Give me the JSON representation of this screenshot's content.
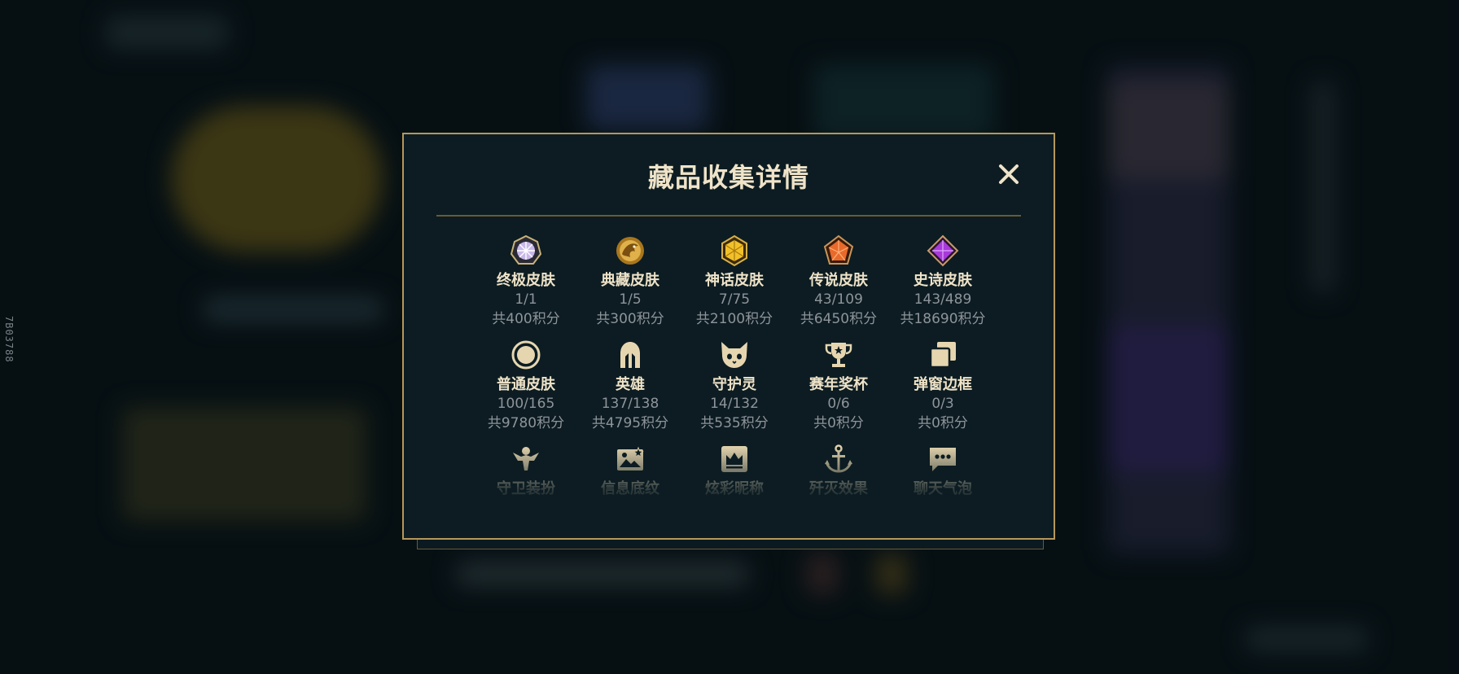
{
  "background": {
    "side_code": "7B03788"
  },
  "modal": {
    "title": "藏品收集详情",
    "close_label": "✕",
    "colors": {
      "accent": "#b5975a",
      "title": "#efe3c8",
      "muted": "#8e949a"
    },
    "rows": [
      [
        {
          "icon": "ultimate-skin-gem-icon",
          "name": "终极皮肤",
          "count": "1/1",
          "points": "共400积分"
        },
        {
          "icon": "collector-skin-dragon-icon",
          "name": "典藏皮肤",
          "count": "1/5",
          "points": "共300积分"
        },
        {
          "icon": "mythic-skin-gem-icon",
          "name": "神话皮肤",
          "count": "7/75",
          "points": "共2100积分"
        },
        {
          "icon": "legendary-skin-gem-icon",
          "name": "传说皮肤",
          "count": "43/109",
          "points": "共6450积分"
        },
        {
          "icon": "epic-skin-gem-icon",
          "name": "史诗皮肤",
          "count": "143/489",
          "points": "共18690积分"
        }
      ],
      [
        {
          "icon": "normal-skin-circle-icon",
          "name": "普通皮肤",
          "count": "100/165",
          "points": "共9780积分"
        },
        {
          "icon": "champion-helmet-icon",
          "name": "英雄",
          "count": "137/138",
          "points": "共4795积分"
        },
        {
          "icon": "guardian-creature-icon",
          "name": "守护灵",
          "count": "14/132",
          "points": "共535积分"
        },
        {
          "icon": "trophy-icon",
          "name": "赛年奖杯",
          "count": "0/6",
          "points": "共0积分"
        },
        {
          "icon": "popup-frame-icon",
          "name": "弹窗边框",
          "count": "0/3",
          "points": "共0积分"
        }
      ],
      [
        {
          "icon": "ward-skin-icon",
          "name": "守卫装扮",
          "count": "",
          "points": ""
        },
        {
          "icon": "profile-background-icon",
          "name": "信息底纹",
          "count": "",
          "points": ""
        },
        {
          "icon": "colorful-nickname-crown-icon",
          "name": "炫彩昵称",
          "count": "",
          "points": ""
        },
        {
          "icon": "elimination-effect-anchor-icon",
          "name": "歼灭效果",
          "count": "",
          "points": ""
        },
        {
          "icon": "chat-bubble-icon",
          "name": "聊天气泡",
          "count": "",
          "points": ""
        }
      ]
    ]
  }
}
